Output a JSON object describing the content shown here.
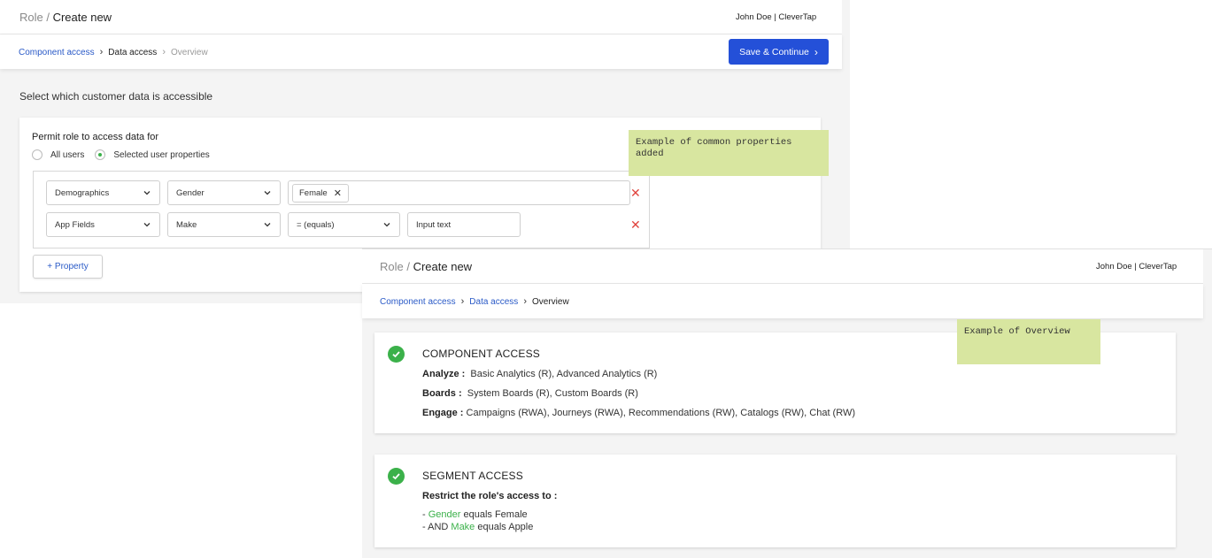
{
  "screen_a": {
    "breadcrumb_root": "Role /",
    "title": "Create new",
    "user": "John Doe | CleverTap",
    "steps": [
      "Component access",
      "Data access",
      "Overview"
    ],
    "save_button": "Save & Continue",
    "section_title": "Select which customer data is accessible",
    "permit_label": "Permit role to access data for",
    "radio_options": [
      "All users",
      "Selected user properties"
    ],
    "selected_radio": "Selected user properties",
    "rules": [
      {
        "category": "Demographics",
        "property": "Gender",
        "value_chip": "Female"
      },
      {
        "category": "App Fields",
        "property": "Make",
        "operator": "= (equals)",
        "value_placeholder": "Input text"
      }
    ],
    "add_property_button": "+ Property"
  },
  "notes": {
    "common_properties": "Example of common properties added",
    "overview": "Example of Overview"
  },
  "screen_b": {
    "breadcrumb_root": "Role /",
    "title": "Create new",
    "user": "John Doe | CleverTap",
    "steps": [
      "Component access",
      "Data access",
      "Overview"
    ],
    "component_card": {
      "heading": "COMPONENT ACCESS",
      "rows": [
        {
          "label": "Analyze :",
          "value": "Basic Analytics (R), Advanced Analytics (R)"
        },
        {
          "label": "Boards :",
          "value": "System Boards (R), Custom Boards (R)"
        },
        {
          "label": "Engage :",
          "value": "Campaigns (RWA), Journeys (RWA), Recommendations (RW),  Catalogs (RW), Chat (RW)"
        }
      ]
    },
    "segment_card": {
      "heading": "SEGMENT ACCESS",
      "restrict_label": "Restrict the role's access to :",
      "conditions": [
        {
          "prefix": "- ",
          "property": "Gender",
          "rest": " equals Female"
        },
        {
          "prefix": "- AND ",
          "property": "Make",
          "rest": " equals Apple"
        }
      ]
    }
  },
  "colors": {
    "accent": "#2450d8",
    "link": "#2a5ac7",
    "success": "#3bb14a",
    "danger": "#e0443e",
    "note": "#d8e6a0"
  }
}
